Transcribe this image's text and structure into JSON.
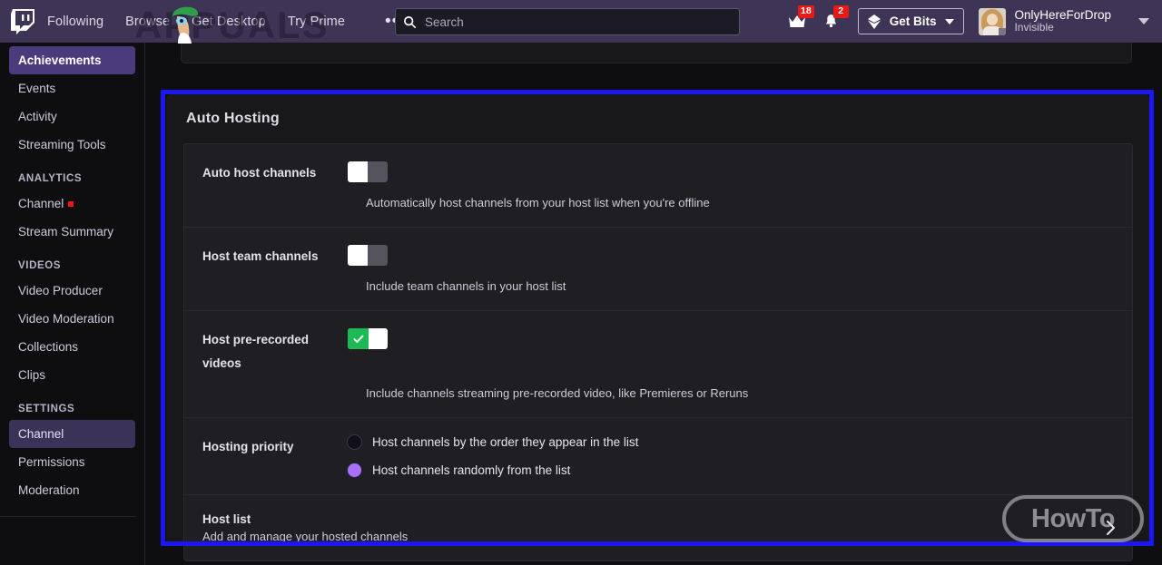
{
  "topnav": {
    "logo_icon": "twitch-logo-icon",
    "links": [
      {
        "label": "Following"
      },
      {
        "label": "Browse"
      },
      {
        "label": "Get Desktop"
      },
      {
        "label": "Try Prime"
      }
    ],
    "more_label": "•••",
    "search": {
      "placeholder": "Search",
      "value": "",
      "icon": "search-icon"
    },
    "crown": {
      "icon": "crown-icon",
      "badge": "18"
    },
    "bell": {
      "icon": "bell-icon",
      "badge": "2"
    },
    "bits": {
      "label": "Get Bits",
      "icon": "bits-diamond-icon",
      "caret": "chevron-down-icon"
    },
    "user": {
      "name": "OnlyHereForDrop",
      "status": "Invisible",
      "avatar": "user-avatar",
      "caret": "chevron-down-icon"
    }
  },
  "sidebar": {
    "items": [
      {
        "label": "Achievements",
        "state": "active"
      },
      {
        "label": "Events",
        "state": "normal"
      },
      {
        "label": "Activity",
        "state": "normal"
      },
      {
        "label": "Streaming Tools",
        "state": "normal"
      }
    ],
    "analytics": {
      "title": "ANALYTICS",
      "items": [
        {
          "label": "Channel",
          "dot": true
        },
        {
          "label": "Stream Summary",
          "dot": false
        }
      ]
    },
    "videos": {
      "title": "VIDEOS",
      "items": [
        {
          "label": "Video Producer"
        },
        {
          "label": "Video Moderation"
        },
        {
          "label": "Collections"
        },
        {
          "label": "Clips"
        }
      ]
    },
    "settings": {
      "title": "SETTINGS",
      "items": [
        {
          "label": "Channel",
          "state": "selected"
        },
        {
          "label": "Permissions",
          "state": "normal"
        },
        {
          "label": "Moderation",
          "state": "normal"
        }
      ]
    }
  },
  "main": {
    "card_title": "Auto Hosting",
    "rows": [
      {
        "label": "Auto host channels",
        "toggle_state": "off",
        "description": "Automatically host channels from your host list when you're offline"
      },
      {
        "label": "Host team channels",
        "toggle_state": "off",
        "description": "Include team channels in your host list"
      },
      {
        "label": "Host pre-recorded videos",
        "toggle_state": "on",
        "description": "Include channels streaming pre-recorded video, like Premieres or Reruns"
      }
    ],
    "priority": {
      "label": "Hosting priority",
      "options": [
        {
          "label": "Host channels by the order they appear in the list",
          "selected": false
        },
        {
          "label": "Host channels randomly from the list",
          "selected": true
        }
      ]
    },
    "host_list": {
      "title": "Host list",
      "subtitle": "Add and manage your hosted channels",
      "chevron": "chevron-right-icon"
    }
  },
  "watermarks": {
    "appuals": "APPUALS",
    "howto": "HowTo"
  },
  "annotation": {
    "color": "#1a18f0"
  }
}
